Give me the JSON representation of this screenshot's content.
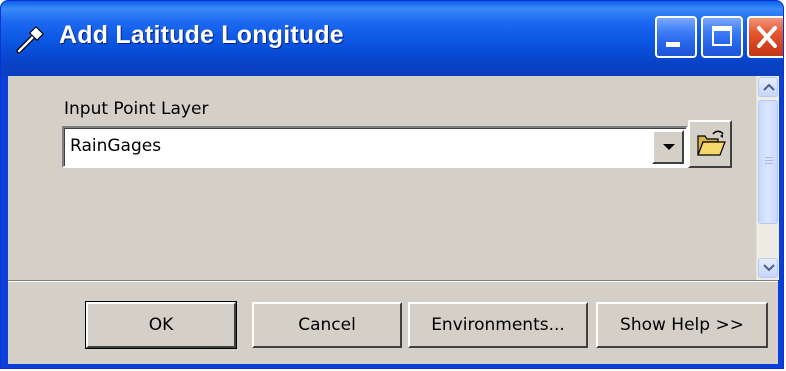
{
  "window": {
    "title": "Add Latitude Longitude",
    "icon": "hammer-icon",
    "controls": [
      "minimize-icon",
      "maximize-icon",
      "close-icon"
    ]
  },
  "form": {
    "field_label": "Input Point Layer",
    "field_value": "RainGages",
    "browse_icon": "open-folder-icon"
  },
  "buttons": {
    "ok": "OK",
    "cancel": "Cancel",
    "environments": "Environments...",
    "show_help": "Show Help >>"
  },
  "colors": {
    "titlebar": "#0a55e2",
    "dialog_face": "#d4d0c8",
    "close_button": "#d2401d"
  }
}
